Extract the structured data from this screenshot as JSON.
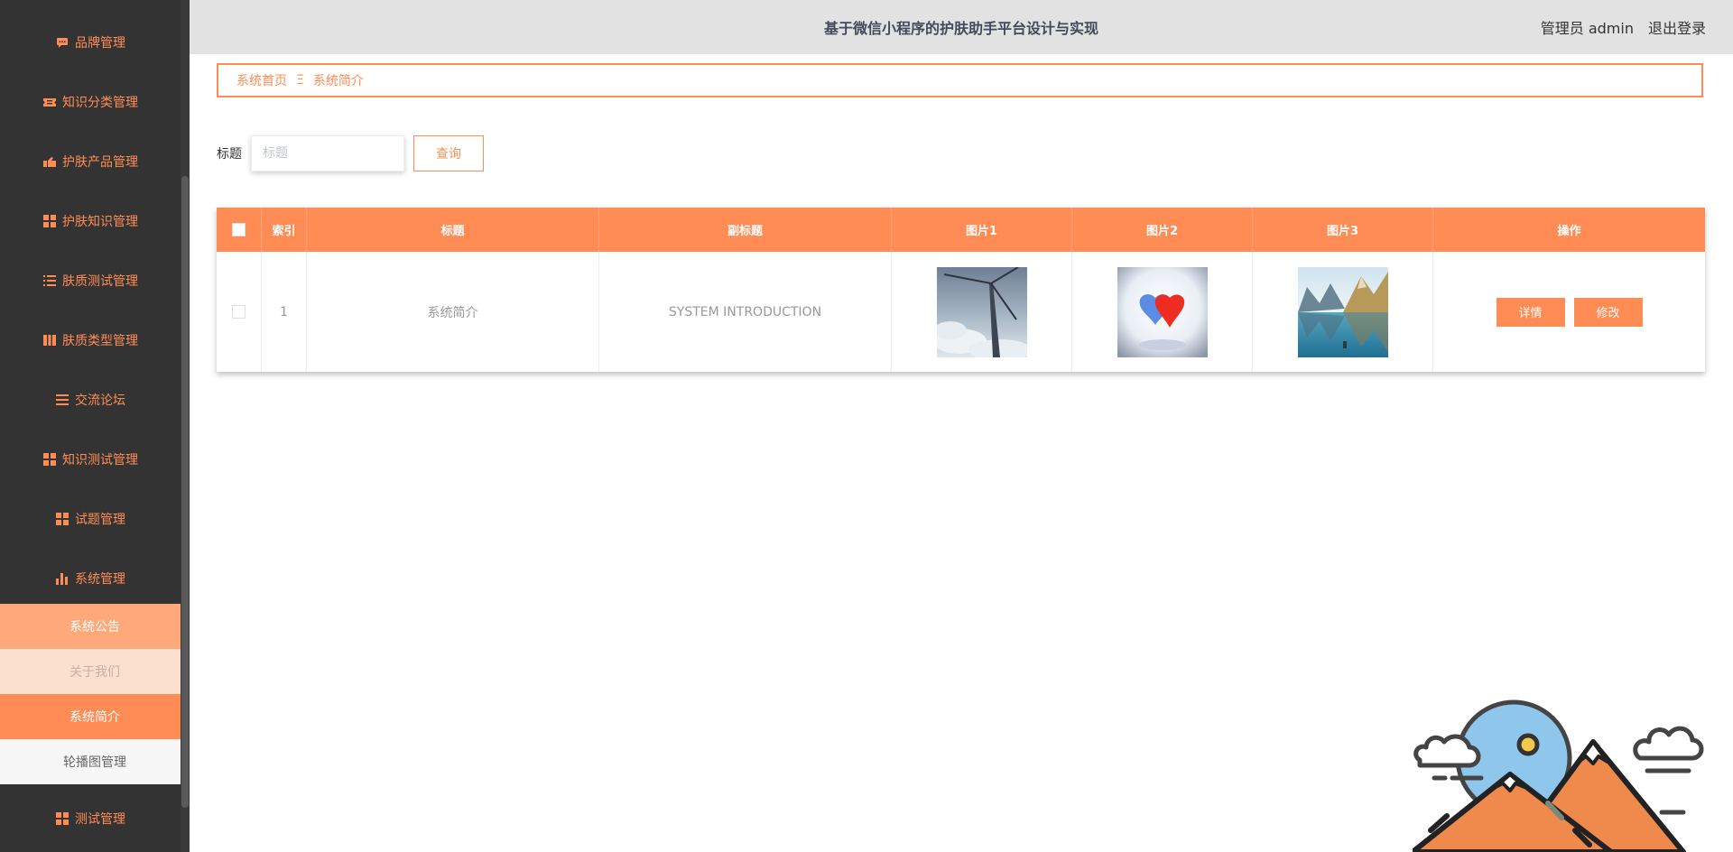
{
  "app": {
    "title": "基于微信小程序的护肤助手平台设计与实现",
    "user_label": "管理员 admin",
    "logout_label": "退出登录"
  },
  "sidebar": {
    "items": [
      {
        "label": "品牌管理",
        "icon": "chat-icon"
      },
      {
        "label": "知识分类管理",
        "icon": "ticket-icon"
      },
      {
        "label": "护肤产品管理",
        "icon": "hand-icon"
      },
      {
        "label": "护肤知识管理",
        "icon": "grid-icon"
      },
      {
        "label": "肤质测试管理",
        "icon": "list-icon"
      },
      {
        "label": "肤质类型管理",
        "icon": "book-icon"
      },
      {
        "label": "交流论坛",
        "icon": "bars-icon"
      },
      {
        "label": "知识测试管理",
        "icon": "grid-icon"
      },
      {
        "label": "试题管理",
        "icon": "grid-icon"
      },
      {
        "label": "系统管理",
        "icon": "chart-icon"
      }
    ],
    "submenu": [
      {
        "label": "系统公告"
      },
      {
        "label": "关于我们"
      },
      {
        "label": "系统简介"
      },
      {
        "label": "轮播图管理"
      }
    ],
    "bottom_item": {
      "label": "测试管理",
      "icon": "grid-icon"
    },
    "active_submenu": "系统简介"
  },
  "breadcrumb": {
    "home": "系统首页",
    "separator": "Ξ",
    "current": "系统简介"
  },
  "search": {
    "label": "标题",
    "placeholder": "标题",
    "value": "",
    "button_label": "查询"
  },
  "table": {
    "headers": {
      "index": "索引",
      "title": "标题",
      "subtitle": "副标题",
      "image1": "图片1",
      "image2": "图片2",
      "image3": "图片3",
      "actions": "操作"
    },
    "rows": [
      {
        "index": "1",
        "title": "系统简介",
        "subtitle": "SYSTEM INTRODUCTION",
        "image1": "wind-turbine-photo",
        "image2": "heart-balloons-photo",
        "image3": "mountain-lake-photo",
        "detail_label": "详情",
        "edit_label": "修改"
      }
    ]
  },
  "colors": {
    "accent": "#ff8c55",
    "sidebar_bg": "#333333",
    "header_bg": "#e2e2e2",
    "submenu_1": "#ffa97a",
    "submenu_2": "#fbdfcf",
    "submenu_active": "#ff8c55",
    "submenu_4": "#f7f7f7"
  }
}
